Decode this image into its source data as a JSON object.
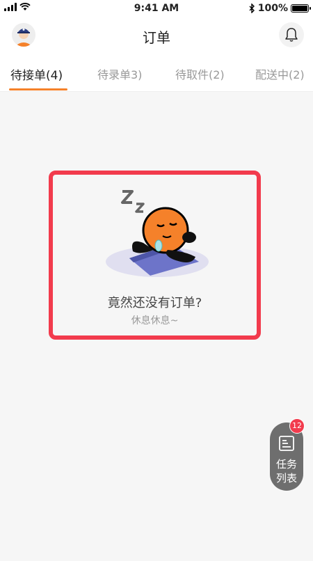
{
  "status_bar": {
    "time": "9:41 AM",
    "battery": "100%"
  },
  "header": {
    "title": "订单"
  },
  "tabs": [
    {
      "label": "待接单(4)",
      "active": true
    },
    {
      "label": "待录单3)",
      "active": false
    },
    {
      "label": "待取件(2)",
      "active": false
    },
    {
      "label": "配送中(2)",
      "active": false
    }
  ],
  "empty_state": {
    "message": "竟然还没有订单?",
    "subtext": "休息休息~"
  },
  "task_fab": {
    "label_line1": "任务",
    "label_line2": "列表",
    "badge_count": "12"
  },
  "colors": {
    "accent": "#f5812a",
    "highlight_border": "#f23b4d",
    "badge": "#f23b4d",
    "fab_bg": "#6e6e6e"
  }
}
